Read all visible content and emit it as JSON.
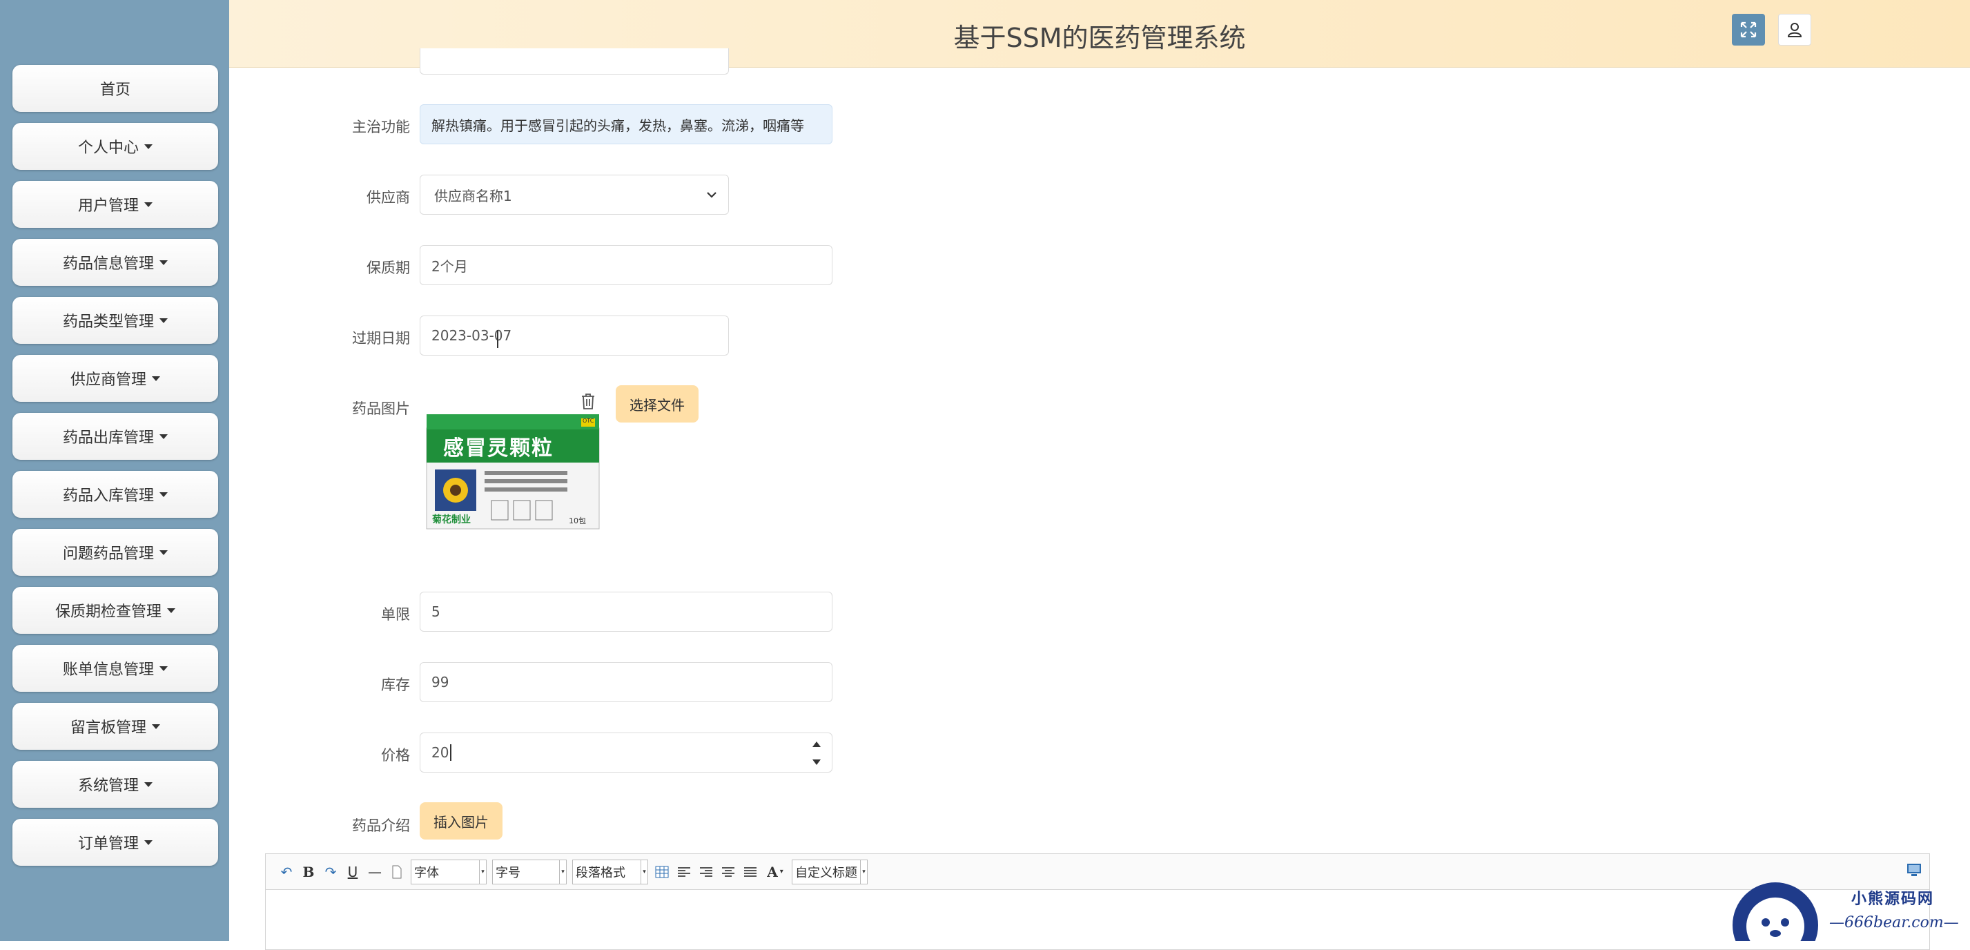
{
  "sidebar": {
    "items": [
      {
        "label": "首页",
        "caret": false
      },
      {
        "label": "个人中心",
        "caret": true
      },
      {
        "label": "用户管理",
        "caret": true
      },
      {
        "label": "药品信息管理",
        "caret": true
      },
      {
        "label": "药品类型管理",
        "caret": true
      },
      {
        "label": "供应商管理",
        "caret": true
      },
      {
        "label": "药品出库管理",
        "caret": true
      },
      {
        "label": "药品入库管理",
        "caret": true
      },
      {
        "label": "问题药品管理",
        "caret": true
      },
      {
        "label": "保质期检查管理",
        "caret": true
      },
      {
        "label": "账单信息管理",
        "caret": true
      },
      {
        "label": "留言板管理",
        "caret": true
      },
      {
        "label": "系统管理",
        "caret": true
      },
      {
        "label": "订单管理",
        "caret": true
      }
    ]
  },
  "header": {
    "title": "基于SSM的医药管理系统"
  },
  "form": {
    "main_function": {
      "label": "主治功能",
      "value": "解热镇痛。用于感冒引起的头痛，发热，鼻塞。流涕，咽痛等"
    },
    "supplier": {
      "label": "供应商",
      "value": "供应商名称1"
    },
    "shelf_life": {
      "label": "保质期",
      "value": "2个月"
    },
    "expire_date": {
      "label": "过期日期",
      "value": "2023-03-07"
    },
    "drug_image": {
      "label": "药品图片",
      "button": "选择文件"
    },
    "limit": {
      "label": "单限",
      "value": "5"
    },
    "stock": {
      "label": "库存",
      "value": "99"
    },
    "price": {
      "label": "价格",
      "value": "20"
    },
    "intro": {
      "label": "药品介绍",
      "button": "插入图片"
    }
  },
  "product": {
    "name": "感冒灵颗粒",
    "brand": "菊花制业",
    "badge": "OTC",
    "count": "10包"
  },
  "editor": {
    "font_family": "字体",
    "font_size": "字号",
    "paragraph": "段落格式",
    "custom_title": "自定义标题"
  },
  "watermark": {
    "line1": "小熊源码网",
    "line2": "—666bear.com—"
  },
  "colors": {
    "sidebar": "#7a9fb8",
    "header": "#fde7bd",
    "accent_button": "#ffdfa7",
    "expand_button": "#5f8fb1"
  }
}
